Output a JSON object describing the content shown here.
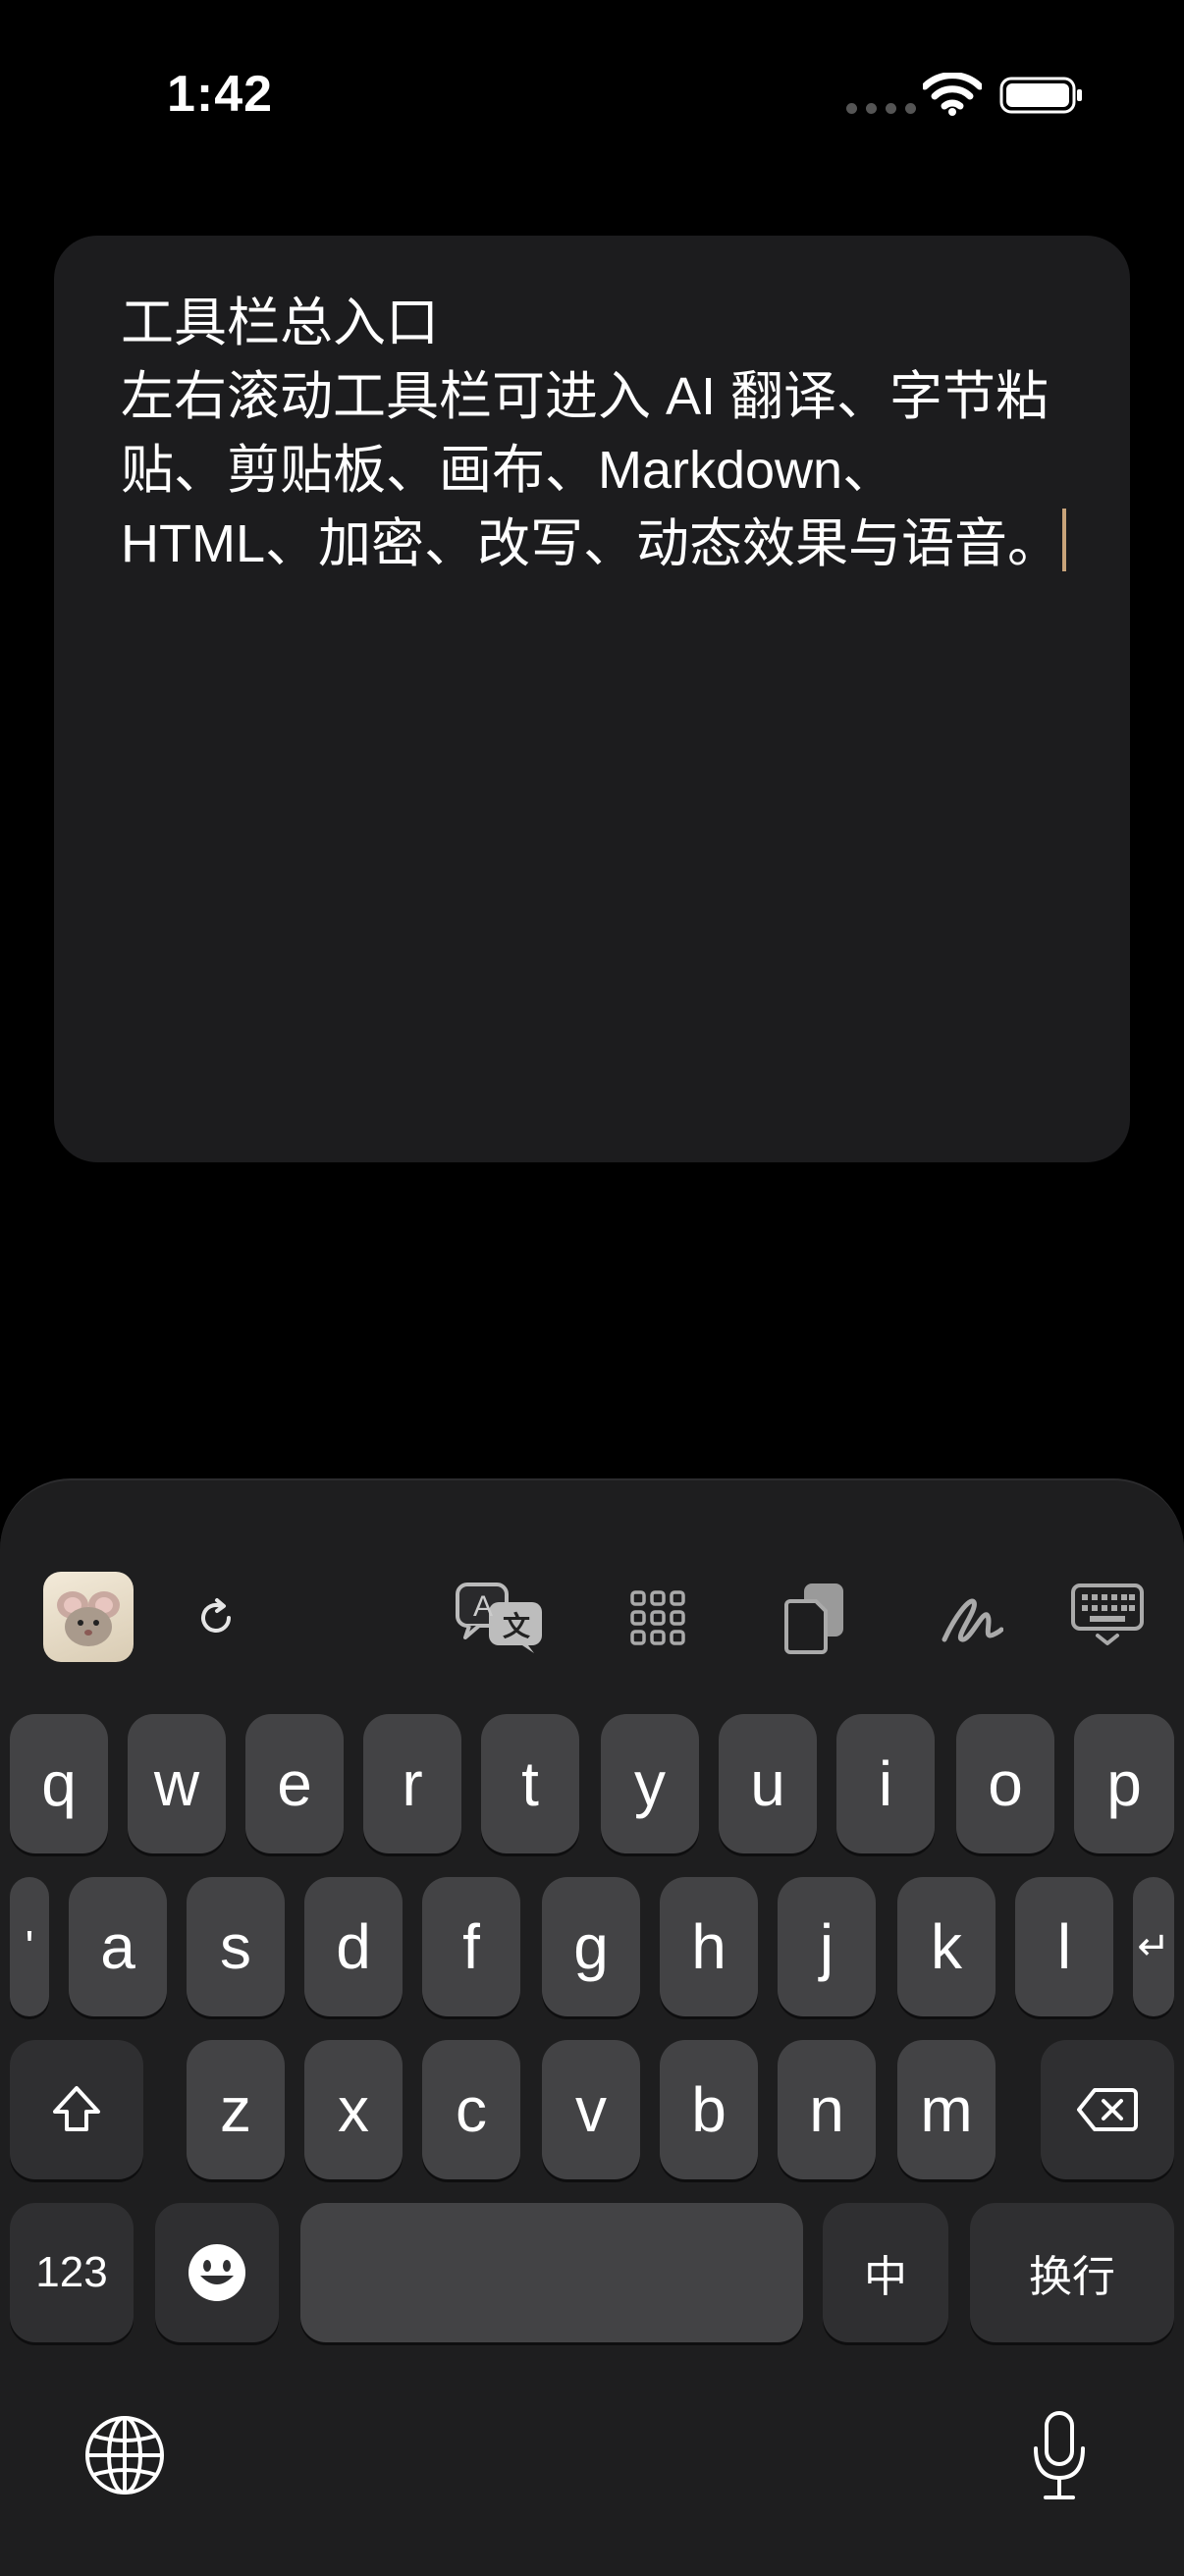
{
  "status_bar": {
    "time": "1:42"
  },
  "editor": {
    "text": "工具栏总入口\n左右滚动工具栏可进入 AI 翻译、字节粘贴、剪贴板、画布、Markdown、HTML、加密、改写、动态效果与语音。"
  },
  "toolbar": {
    "icons": [
      "app-avatar-icon",
      "refresh-icon",
      "translate-icon",
      "grid-icon",
      "clipboard-icon",
      "handwriting-icon",
      "keyboard-dismiss-icon"
    ],
    "translate_glyph_a": "A",
    "translate_glyph_wen": "文"
  },
  "keyboard": {
    "row1": [
      "q",
      "w",
      "e",
      "r",
      "t",
      "y",
      "u",
      "i",
      "o",
      "p"
    ],
    "row2": [
      "'",
      "a",
      "s",
      "d",
      "f",
      "g",
      "h",
      "j",
      "k",
      "l",
      "↵"
    ],
    "row3": [
      "z",
      "x",
      "c",
      "v",
      "b",
      "n",
      "m"
    ],
    "numbers_label": "123",
    "lang_label": "中",
    "return_label": "换行",
    "space_label": ""
  },
  "colors": {
    "background": "#000000",
    "editor_bg": "#1c1c1e",
    "key_bg": "#434345",
    "caret": "#c8a37a"
  }
}
